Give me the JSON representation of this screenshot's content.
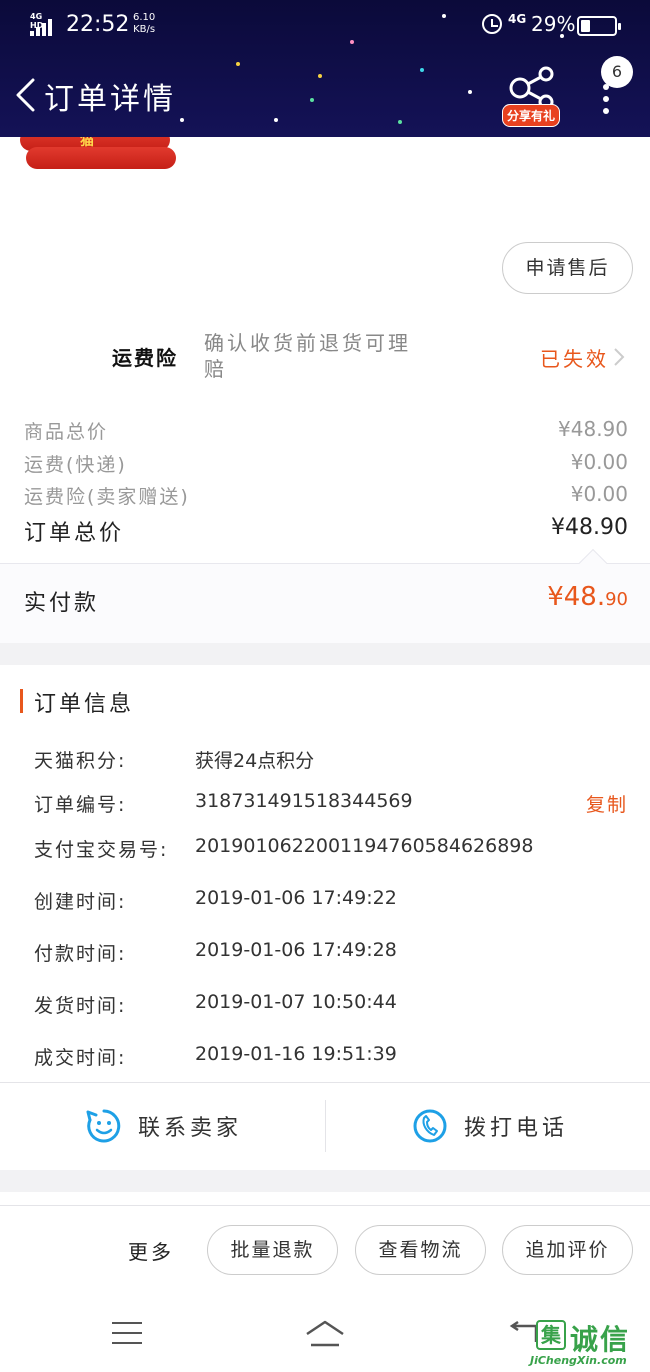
{
  "status_bar": {
    "network": "4G HD",
    "time": "22:52",
    "speed_value": "6.10",
    "speed_unit": "KB/s",
    "data_type": "4G",
    "battery": "29%",
    "battery_level": 0.29
  },
  "header": {
    "title": "订单详情",
    "share_label": "分享有礼",
    "message_count": "6",
    "background_color": "#0b0a3a"
  },
  "product": {
    "image_text": "猫"
  },
  "after_sale": {
    "label": "申请售后"
  },
  "insurance": {
    "name": "运费险",
    "description": "确认收货前退货可理赔",
    "status": "已失效",
    "status_color": "#e8571c"
  },
  "fees": [
    {
      "label": "商品总价",
      "value": "¥48.90"
    },
    {
      "label": "运费(快递)",
      "value": "¥0.00"
    },
    {
      "label": "运费险(卖家赠送)",
      "value": "¥0.00"
    }
  ],
  "total": {
    "label": "订单总价",
    "value": "¥48.90"
  },
  "paid": {
    "label": "实付款",
    "currency_integer": "¥48.",
    "decimal": "90"
  },
  "order_info": {
    "title": "订单信息",
    "rows": [
      {
        "label": "天猫积分:",
        "value": "获得24点积分"
      },
      {
        "label": "订单编号:",
        "value": "318731491518344569"
      },
      {
        "label": "支付宝交易号:",
        "value": "2019010622001194760584626898"
      },
      {
        "label": "创建时间:",
        "value": "2019-01-06 17:49:22"
      },
      {
        "label": "付款时间:",
        "value": "2019-01-06 17:49:28"
      },
      {
        "label": "发货时间:",
        "value": "2019-01-07 10:50:44"
      },
      {
        "label": "成交时间:",
        "value": "2019-01-16 19:51:39"
      }
    ],
    "copy_label": "复制"
  },
  "contact": {
    "seller_label": "联系卖家",
    "phone_label": "拨打电话",
    "icon_color": "#1ea0e6"
  },
  "actions": {
    "more_label": "更多",
    "buttons": [
      "批量退款",
      "查看物流",
      "追加评价"
    ]
  },
  "watermark": {
    "box_char": "集",
    "text": "诚信",
    "url": "JiChengXin.com"
  }
}
